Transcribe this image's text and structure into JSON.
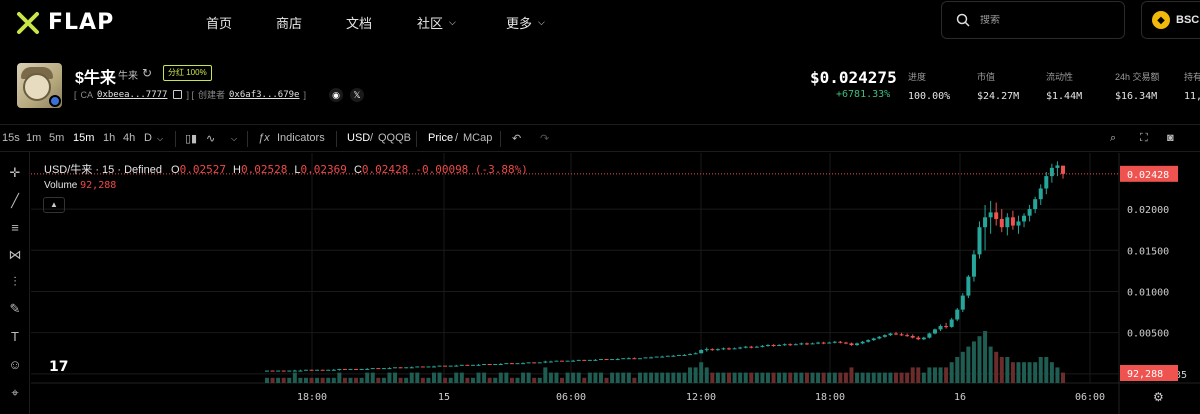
{
  "nav": {
    "brand": "FLAP",
    "items": [
      "首页",
      "商店",
      "文档",
      "社区",
      "更多"
    ],
    "search_placeholder": "搜索",
    "chain": "BSC"
  },
  "token": {
    "symbol": "$牛来",
    "name": "牛来",
    "badge": "分红 100%",
    "ca_label": "CA",
    "ca_addr": "0xbeea...7777",
    "creator_label": "创建者",
    "creator_addr": "0x6af3...679e",
    "price": "$0.024275",
    "change": "+6781.33%",
    "stats": [
      {
        "label": "进度",
        "value": "100.00%"
      },
      {
        "label": "市值",
        "value": "$24.27M"
      },
      {
        "label": "流动性",
        "value": "$1.44M"
      },
      {
        "label": "24h 交易额",
        "value": "$16.34M"
      },
      {
        "label": "持有",
        "value": "11,"
      }
    ]
  },
  "toolbar": {
    "intervals": [
      "15s",
      "1m",
      "5m",
      "15m",
      "1h",
      "4h",
      "D"
    ],
    "active_interval": "15m",
    "indicators": "Indicators",
    "usd": "USD",
    "quote": "QQQB",
    "price": "Price",
    "mcap": "MCap"
  },
  "legend": {
    "pair": "USD/牛来 · 15 · Defined",
    "o_label": "O",
    "o": "0.02527",
    "h_label": "H",
    "h": "0.02528",
    "l_label": "L",
    "l": "0.02369",
    "c_label": "C",
    "c": "0.02428",
    "chg": "-0.00098 (-3.88%)",
    "volume_label": "Volume",
    "volume": "92,288"
  },
  "chart_data": {
    "type": "candlestick",
    "y_ticks": [
      "0.02000",
      "0.01500",
      "0.01000",
      "0.00500",
      "-0.0"
    ],
    "y_tick_values": [
      0.02,
      0.015,
      0.01,
      0.005,
      0.0
    ],
    "y_range": [
      -0.0005,
      0.0262
    ],
    "x_ticks": [
      "18:00",
      "15",
      "06:00",
      "12:00",
      "18:00",
      "16",
      "06:00"
    ],
    "last_price_label": "0.02428",
    "last_price": 0.02428,
    "volume_label": "92,288",
    "partial_label": "1735",
    "candles": [
      [
        0.0003,
        0.0004,
        0.0003,
        0.0004,
        1
      ],
      [
        0.0004,
        0.0004,
        0.0003,
        0.0003,
        1
      ],
      [
        0.0003,
        0.0004,
        0.0003,
        0.0004,
        1
      ],
      [
        0.0004,
        0.0004,
        0.0003,
        0.0003,
        1
      ],
      [
        0.0003,
        0.0004,
        0.0003,
        0.0004,
        1
      ],
      [
        0.0004,
        0.0005,
        0.0003,
        0.0004,
        2
      ],
      [
        0.0004,
        0.0005,
        0.0004,
        0.0004,
        1
      ],
      [
        0.0004,
        0.0005,
        0.0004,
        0.0005,
        1
      ],
      [
        0.0005,
        0.0005,
        0.0004,
        0.0004,
        1
      ],
      [
        0.0004,
        0.0005,
        0.0004,
        0.0005,
        1
      ],
      [
        0.0005,
        0.0005,
        0.0004,
        0.0004,
        1
      ],
      [
        0.0004,
        0.0005,
        0.0004,
        0.0005,
        1
      ],
      [
        0.0005,
        0.0006,
        0.0004,
        0.0005,
        1
      ],
      [
        0.0005,
        0.0006,
        0.0004,
        0.0006,
        2
      ],
      [
        0.0006,
        0.0006,
        0.0005,
        0.0005,
        1
      ],
      [
        0.0005,
        0.0006,
        0.0005,
        0.0006,
        1
      ],
      [
        0.0006,
        0.0006,
        0.0005,
        0.0005,
        1
      ],
      [
        0.0005,
        0.0006,
        0.0005,
        0.0006,
        1
      ],
      [
        0.0006,
        0.0007,
        0.0005,
        0.0006,
        2
      ],
      [
        0.0006,
        0.0007,
        0.0006,
        0.0007,
        2
      ],
      [
        0.0007,
        0.0007,
        0.0006,
        0.0006,
        1
      ],
      [
        0.0006,
        0.0007,
        0.0006,
        0.0007,
        1
      ],
      [
        0.0007,
        0.0008,
        0.0006,
        0.0007,
        2
      ],
      [
        0.0007,
        0.0008,
        0.0007,
        0.0008,
        2
      ],
      [
        0.0008,
        0.0008,
        0.0007,
        0.0007,
        1
      ],
      [
        0.0007,
        0.0008,
        0.0007,
        0.0008,
        1
      ],
      [
        0.0008,
        0.0009,
        0.0007,
        0.0008,
        2
      ],
      [
        0.0008,
        0.0009,
        0.0008,
        0.0009,
        2
      ],
      [
        0.0009,
        0.0009,
        0.0008,
        0.0008,
        1
      ],
      [
        0.0008,
        0.0009,
        0.0008,
        0.0009,
        1
      ],
      [
        0.0009,
        0.001,
        0.0008,
        0.0009,
        2
      ],
      [
        0.0009,
        0.001,
        0.0009,
        0.001,
        2
      ],
      [
        0.001,
        0.001,
        0.0009,
        0.0009,
        1
      ],
      [
        0.0009,
        0.001,
        0.0009,
        0.001,
        1
      ],
      [
        0.001,
        0.0011,
        0.0009,
        0.001,
        2
      ],
      [
        0.001,
        0.0011,
        0.001,
        0.0011,
        2
      ],
      [
        0.0011,
        0.0011,
        0.001,
        0.001,
        1
      ],
      [
        0.001,
        0.0011,
        0.001,
        0.0011,
        1
      ],
      [
        0.0011,
        0.0012,
        0.001,
        0.0011,
        2
      ],
      [
        0.0011,
        0.0012,
        0.0011,
        0.0012,
        2
      ],
      [
        0.0012,
        0.0012,
        0.0011,
        0.0011,
        1
      ],
      [
        0.0011,
        0.0012,
        0.0011,
        0.0012,
        1
      ],
      [
        0.0012,
        0.0013,
        0.0011,
        0.0012,
        2
      ],
      [
        0.0012,
        0.0013,
        0.0012,
        0.0013,
        2
      ],
      [
        0.0013,
        0.0013,
        0.0012,
        0.0012,
        1
      ],
      [
        0.0012,
        0.0013,
        0.0012,
        0.0013,
        1
      ],
      [
        0.0013,
        0.0014,
        0.0012,
        0.0013,
        2
      ],
      [
        0.0013,
        0.0014,
        0.0013,
        0.0014,
        2
      ],
      [
        0.0014,
        0.0014,
        0.0013,
        0.0013,
        1
      ],
      [
        0.0013,
        0.0014,
        0.0013,
        0.0014,
        1
      ],
      [
        0.0014,
        0.0016,
        0.0013,
        0.0015,
        3
      ],
      [
        0.0015,
        0.0016,
        0.0014,
        0.0015,
        2
      ],
      [
        0.0015,
        0.0016,
        0.0015,
        0.0016,
        2
      ],
      [
        0.0016,
        0.0016,
        0.0015,
        0.0015,
        1
      ],
      [
        0.0015,
        0.0016,
        0.0015,
        0.0016,
        2
      ],
      [
        0.0016,
        0.0017,
        0.0015,
        0.0016,
        2
      ],
      [
        0.0016,
        0.0017,
        0.0016,
        0.0017,
        2
      ],
      [
        0.0017,
        0.0017,
        0.0016,
        0.0016,
        1
      ],
      [
        0.0016,
        0.0017,
        0.0016,
        0.0017,
        2
      ],
      [
        0.0017,
        0.0018,
        0.0016,
        0.0017,
        2
      ],
      [
        0.0017,
        0.0018,
        0.0017,
        0.0018,
        2
      ],
      [
        0.0018,
        0.0018,
        0.0017,
        0.0017,
        1
      ],
      [
        0.0017,
        0.0018,
        0.0017,
        0.0018,
        2
      ],
      [
        0.0018,
        0.0019,
        0.0017,
        0.0018,
        2
      ],
      [
        0.0018,
        0.0019,
        0.0018,
        0.0019,
        2
      ],
      [
        0.0019,
        0.002,
        0.0018,
        0.0019,
        2
      ],
      [
        0.0019,
        0.002,
        0.0018,
        0.0018,
        1
      ],
      [
        0.0018,
        0.0019,
        0.0018,
        0.0019,
        2
      ],
      [
        0.0019,
        0.002,
        0.0019,
        0.002,
        2
      ],
      [
        0.002,
        0.0021,
        0.0019,
        0.002,
        2
      ],
      [
        0.002,
        0.0021,
        0.002,
        0.0021,
        2
      ],
      [
        0.0021,
        0.0022,
        0.002,
        0.0021,
        2
      ],
      [
        0.0021,
        0.0022,
        0.0021,
        0.0022,
        2
      ],
      [
        0.0022,
        0.0023,
        0.0021,
        0.0022,
        2
      ],
      [
        0.0022,
        0.0023,
        0.0022,
        0.0023,
        2
      ],
      [
        0.0023,
        0.0024,
        0.0022,
        0.0023,
        2
      ],
      [
        0.0023,
        0.0025,
        0.0023,
        0.0024,
        3
      ],
      [
        0.0024,
        0.0026,
        0.0024,
        0.0025,
        3
      ],
      [
        0.0025,
        0.003,
        0.0025,
        0.0029,
        4
      ],
      [
        0.0029,
        0.0032,
        0.0027,
        0.003,
        3
      ],
      [
        0.003,
        0.0031,
        0.0028,
        0.0029,
        2
      ],
      [
        0.0029,
        0.0031,
        0.0028,
        0.003,
        2
      ],
      [
        0.003,
        0.0032,
        0.0029,
        0.0031,
        2
      ],
      [
        0.0031,
        0.0032,
        0.0029,
        0.003,
        2
      ],
      [
        0.003,
        0.0032,
        0.003,
        0.0031,
        2
      ],
      [
        0.0031,
        0.0033,
        0.003,
        0.0032,
        2
      ],
      [
        0.0032,
        0.0034,
        0.0031,
        0.0033,
        2
      ],
      [
        0.0033,
        0.0034,
        0.0031,
        0.0032,
        2
      ],
      [
        0.0032,
        0.0034,
        0.0032,
        0.0033,
        2
      ],
      [
        0.0033,
        0.0035,
        0.0032,
        0.0034,
        2
      ],
      [
        0.0034,
        0.0036,
        0.0033,
        0.0035,
        2
      ],
      [
        0.0035,
        0.0036,
        0.0033,
        0.0034,
        2
      ],
      [
        0.0034,
        0.0036,
        0.0034,
        0.0035,
        2
      ],
      [
        0.0035,
        0.0037,
        0.0034,
        0.0036,
        2
      ],
      [
        0.0036,
        0.0037,
        0.0034,
        0.0035,
        2
      ],
      [
        0.0035,
        0.0037,
        0.0035,
        0.0036,
        2
      ],
      [
        0.0036,
        0.0038,
        0.0035,
        0.0037,
        2
      ],
      [
        0.0037,
        0.0038,
        0.0035,
        0.0036,
        2
      ],
      [
        0.0036,
        0.0038,
        0.0036,
        0.0037,
        2
      ],
      [
        0.0037,
        0.0039,
        0.0036,
        0.0038,
        2
      ],
      [
        0.0038,
        0.0039,
        0.0036,
        0.0037,
        2
      ],
      [
        0.0037,
        0.0039,
        0.0037,
        0.0038,
        2
      ],
      [
        0.0038,
        0.004,
        0.0037,
        0.0039,
        2
      ],
      [
        0.0039,
        0.004,
        0.0037,
        0.0038,
        2
      ],
      [
        0.0038,
        0.0039,
        0.0036,
        0.0037,
        2
      ],
      [
        0.0037,
        0.0038,
        0.0034,
        0.0035,
        3
      ],
      [
        0.0035,
        0.0038,
        0.0034,
        0.0037,
        2
      ],
      [
        0.0037,
        0.004,
        0.0036,
        0.0039,
        2
      ],
      [
        0.0039,
        0.0042,
        0.0038,
        0.0041,
        2
      ],
      [
        0.0041,
        0.0044,
        0.004,
        0.0043,
        2
      ],
      [
        0.0043,
        0.0046,
        0.0042,
        0.0045,
        2
      ],
      [
        0.0045,
        0.0048,
        0.0044,
        0.0047,
        2
      ],
      [
        0.0047,
        0.005,
        0.0046,
        0.0049,
        2
      ],
      [
        0.0049,
        0.0051,
        0.0047,
        0.0048,
        2
      ],
      [
        0.0048,
        0.005,
        0.0046,
        0.0047,
        2
      ],
      [
        0.0047,
        0.0049,
        0.0045,
        0.0046,
        2
      ],
      [
        0.0046,
        0.0048,
        0.0043,
        0.0044,
        3
      ],
      [
        0.0044,
        0.0046,
        0.0041,
        0.0042,
        3
      ],
      [
        0.0042,
        0.0045,
        0.0041,
        0.0044,
        2
      ],
      [
        0.0044,
        0.005,
        0.0043,
        0.0049,
        3
      ],
      [
        0.0049,
        0.0055,
        0.0048,
        0.0054,
        3
      ],
      [
        0.0054,
        0.006,
        0.0052,
        0.0058,
        3
      ],
      [
        0.0058,
        0.0062,
        0.0055,
        0.0057,
        3
      ],
      [
        0.0057,
        0.0068,
        0.0056,
        0.0066,
        4
      ],
      [
        0.0066,
        0.008,
        0.0064,
        0.0078,
        5
      ],
      [
        0.0078,
        0.0098,
        0.0075,
        0.0095,
        6
      ],
      [
        0.0095,
        0.012,
        0.0092,
        0.0118,
        7
      ],
      [
        0.0118,
        0.015,
        0.0112,
        0.0145,
        8
      ],
      [
        0.0145,
        0.0185,
        0.014,
        0.0178,
        9
      ],
      [
        0.0178,
        0.0205,
        0.015,
        0.019,
        10
      ],
      [
        0.019,
        0.021,
        0.017,
        0.0196,
        7
      ],
      [
        0.0196,
        0.0208,
        0.018,
        0.0188,
        6
      ],
      [
        0.0188,
        0.02,
        0.0172,
        0.0178,
        5
      ],
      [
        0.0178,
        0.0195,
        0.0168,
        0.019,
        5
      ],
      [
        0.019,
        0.0198,
        0.0175,
        0.018,
        4
      ],
      [
        0.018,
        0.0192,
        0.017,
        0.0185,
        4
      ],
      [
        0.0185,
        0.0195,
        0.0178,
        0.0192,
        4
      ],
      [
        0.0192,
        0.0205,
        0.0185,
        0.02,
        4
      ],
      [
        0.02,
        0.0215,
        0.0195,
        0.0212,
        4
      ],
      [
        0.0212,
        0.023,
        0.0205,
        0.0225,
        5
      ],
      [
        0.0225,
        0.0245,
        0.0218,
        0.024,
        5
      ],
      [
        0.024,
        0.0255,
        0.0232,
        0.025,
        4
      ],
      [
        0.025,
        0.0258,
        0.024,
        0.0253,
        3
      ],
      [
        0.02527,
        0.02528,
        0.02369,
        0.02428,
        2
      ]
    ]
  },
  "colors": {
    "up": "#26a69a",
    "down": "#ef5350",
    "bg": "#000000",
    "accent": "#c8e64a"
  }
}
